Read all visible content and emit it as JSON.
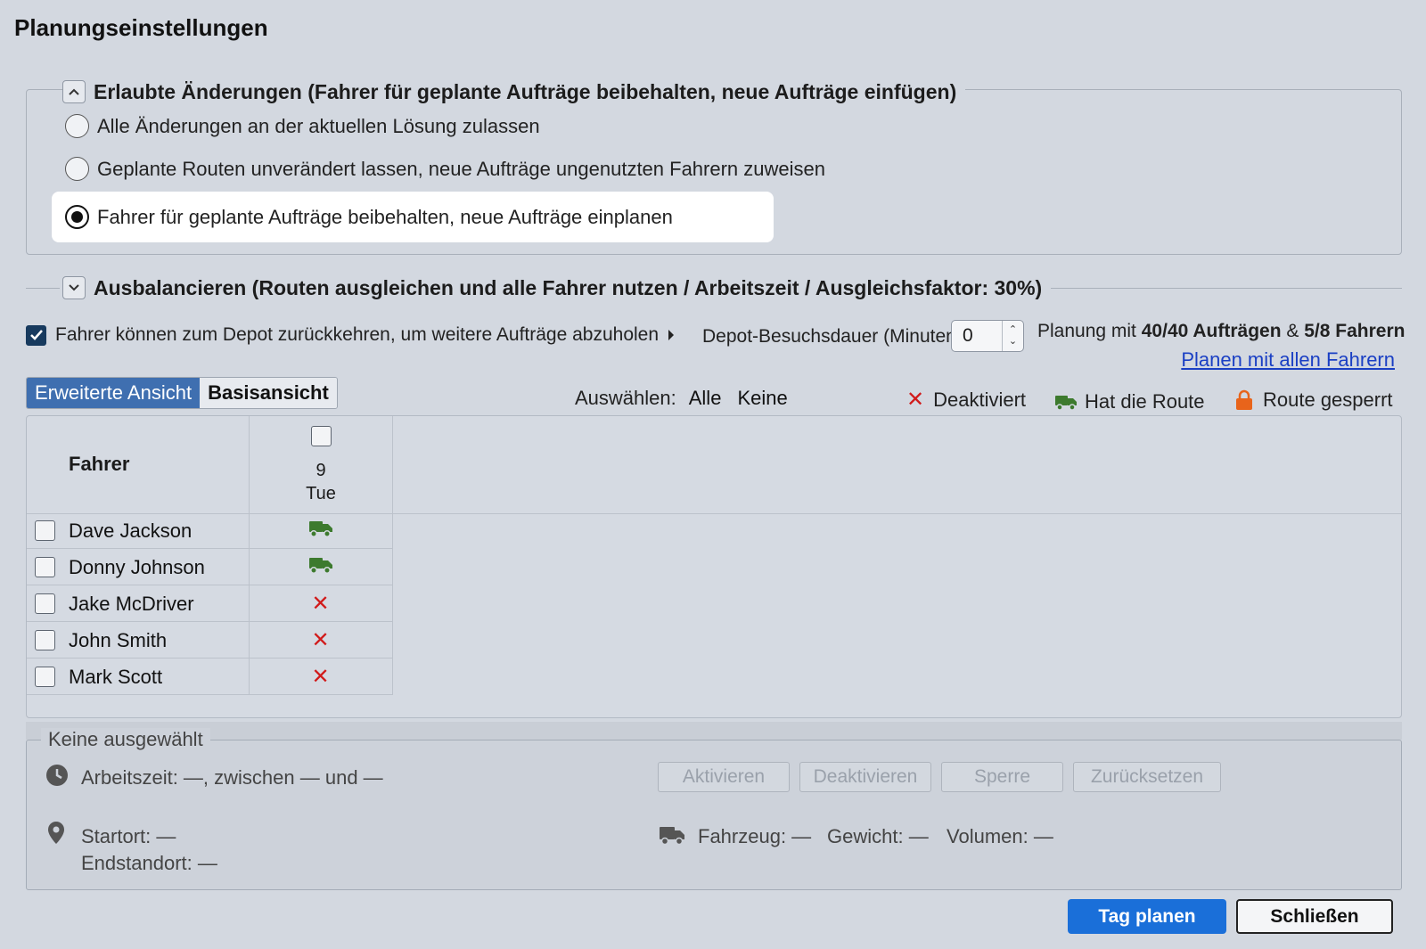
{
  "title": "Planungseinstellungen",
  "section1": {
    "legend": "Erlaubte Änderungen (Fahrer für geplante Aufträge beibehalten, neue Aufträge einfügen)",
    "options": [
      "Alle Änderungen an der aktuellen Lösung zulassen",
      "Geplante Routen unverändert lassen, neue Aufträge ungenutzten Fahrern zuweisen",
      "Fahrer für geplante Aufträge beibehalten, neue Aufträge einplanen"
    ],
    "selected_index": 2
  },
  "section2": {
    "legend": "Ausbalancieren (Routen ausgleichen und alle Fahrer nutzen / Arbeitszeit / Ausgleichsfaktor: 30%)"
  },
  "depot": {
    "checkbox_label": "Fahrer können zum Depot zurückkehren, um weitere Aufträge abzuholen",
    "checked": true,
    "duration_label": "Depot-Besuchsdauer (Minuten):",
    "duration_value": "0"
  },
  "planning": {
    "prefix": "Planung mit",
    "orders": "40/40 Aufträgen",
    "amp": "&",
    "drivers": "5/8 Fahrern",
    "link": "Planen mit allen Fahrern"
  },
  "view": {
    "advanced": "Erweiterte Ansicht",
    "basic": "Basisansicht"
  },
  "select": {
    "label": "Auswählen:",
    "all": "Alle",
    "none": "Keine"
  },
  "legend": {
    "disabled": "Deaktiviert",
    "has_route": "Hat die Route",
    "locked": "Route gesperrt"
  },
  "colors": {
    "accent": "#3f6fb0",
    "primary_button": "#1a6fd9",
    "truck": "#3d7a2e",
    "x": "#d11a1a",
    "lock": "#e8641b"
  },
  "table": {
    "header_driver": "Fahrer",
    "day_number": "9",
    "day_name": "Tue",
    "rows": [
      {
        "name": "Dave Jackson",
        "status": "truck-icon"
      },
      {
        "name": "Donny Johnson",
        "status": "truck-icon"
      },
      {
        "name": "Jake McDriver",
        "status": "x-icon"
      },
      {
        "name": "John Smith",
        "status": "x-icon"
      },
      {
        "name": "Mark Scott",
        "status": "x-icon"
      }
    ]
  },
  "detail": {
    "legend": "Keine ausgewählt",
    "worktime": "Arbeitszeit: —, zwischen — und —",
    "start": "Startort: —",
    "end": "Endstandort: —",
    "vehicle": "Fahrzeug: —",
    "weight": "Gewicht: —",
    "volume": "Volumen: —",
    "buttons": [
      "Aktivieren",
      "Deaktivieren",
      "Sperre",
      "Zurücksetzen"
    ]
  },
  "footer": {
    "plan": "Tag planen",
    "close": "Schließen"
  }
}
